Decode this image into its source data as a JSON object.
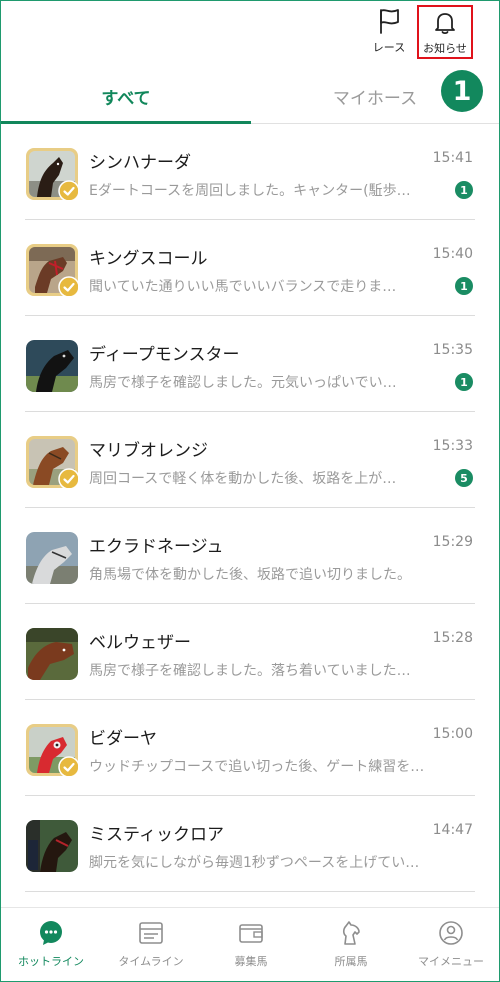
{
  "header": {
    "race_label": "レース",
    "notice_label": "お知らせ"
  },
  "tabs": [
    {
      "label": "すべて",
      "active": true
    },
    {
      "label": "マイホース",
      "active": false
    }
  ],
  "step_badge": "1",
  "messages": [
    {
      "name": "シンハナーダ",
      "time": "15:41",
      "preview": "Eダートコースを周回しました。キャンター(駈歩…",
      "count": "1",
      "verified": true,
      "photo": "dark-bay-horse"
    },
    {
      "name": "キングスコール",
      "time": "15:40",
      "preview": "聞いていた通りいい馬でいいバランスで走りま…",
      "count": "1",
      "verified": true,
      "photo": "bay-horse-red-bridle"
    },
    {
      "name": "ディープモンスター",
      "time": "15:35",
      "preview": "馬房で様子を確認しました。元気いっぱいでい…",
      "count": "1",
      "verified": false,
      "photo": "black-horse"
    },
    {
      "name": "マリブオレンジ",
      "time": "15:33",
      "preview": "周回コースで軽く体を動かした後、坂路を上が…",
      "count": "5",
      "verified": true,
      "photo": "chestnut-horse"
    },
    {
      "name": "エクラドネージュ",
      "time": "15:29",
      "preview": "角馬場で体を動かした後、坂路で追い切りました。",
      "count": "",
      "verified": false,
      "photo": "grey-horse"
    },
    {
      "name": "ベルウェザー",
      "time": "15:28",
      "preview": "馬房で様子を確認しました。落ち着いていました…",
      "count": "",
      "verified": false,
      "photo": "chestnut-horse-stall"
    },
    {
      "name": "ビダーヤ",
      "time": "15:00",
      "preview": "ウッドチップコースで追い切った後、ゲート練習を…",
      "count": "",
      "verified": true,
      "photo": "horse-red-hood"
    },
    {
      "name": "ミスティックロア",
      "time": "14:47",
      "preview": "脚元を気にしながら毎週1秒ずつペースを上げてい…",
      "count": "",
      "verified": false,
      "photo": "dark-horse-handler"
    }
  ],
  "bottom_nav": [
    {
      "label": "ホットライン",
      "icon": "chat-bubble-icon",
      "active": true
    },
    {
      "label": "タイムライン",
      "icon": "timeline-icon",
      "active": false
    },
    {
      "label": "募集馬",
      "icon": "wallet-icon",
      "active": false
    },
    {
      "label": "所属馬",
      "icon": "horse-head-icon",
      "active": false
    },
    {
      "label": "マイメニュー",
      "icon": "user-circle-icon",
      "active": false
    }
  ],
  "colors": {
    "accent": "#12885d",
    "highlight_box": "#e0121b",
    "verified_gold": "#e8cd86"
  }
}
